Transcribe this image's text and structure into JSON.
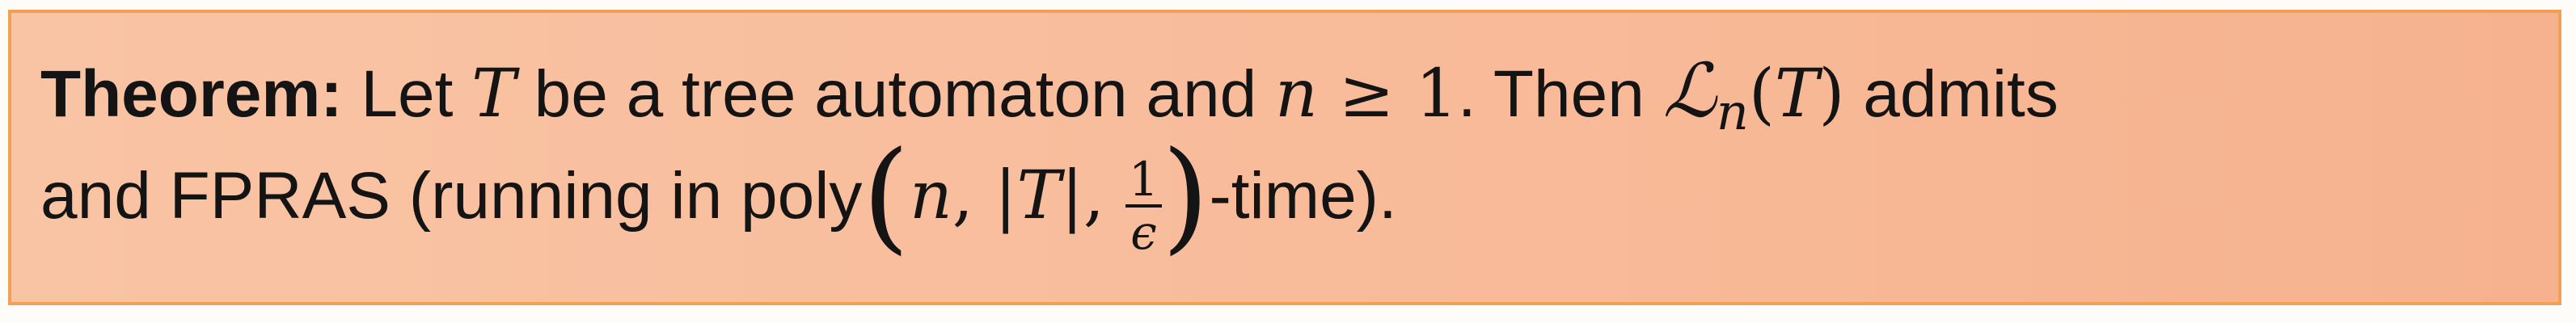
{
  "theorem": {
    "label": "Theorem:",
    "line1": {
      "t1": " Let ",
      "m_T": "T",
      "t2": " be a tree automaton and ",
      "m_n": "n",
      "m_geq": " ≥ 1",
      "t3": ". Then ",
      "m_L": "ℒ",
      "m_sub": "n",
      "m_paren_open": "(",
      "m_T2": "T",
      "m_paren_close": ")",
      "t4": " admits"
    },
    "line2": {
      "t1": "and FPRAS (running in poly",
      "m_big_open": "(",
      "m_n": "n",
      "m_comma1": ", |",
      "m_T": "T",
      "m_bar_comma": "|, ",
      "frac_num": "1",
      "frac_den": "ϵ",
      "m_big_close": ")",
      "t2": "-time)."
    }
  },
  "colors": {
    "box_background": "#f8bc9b",
    "box_border": "#f2a055",
    "text": "#141414"
  }
}
